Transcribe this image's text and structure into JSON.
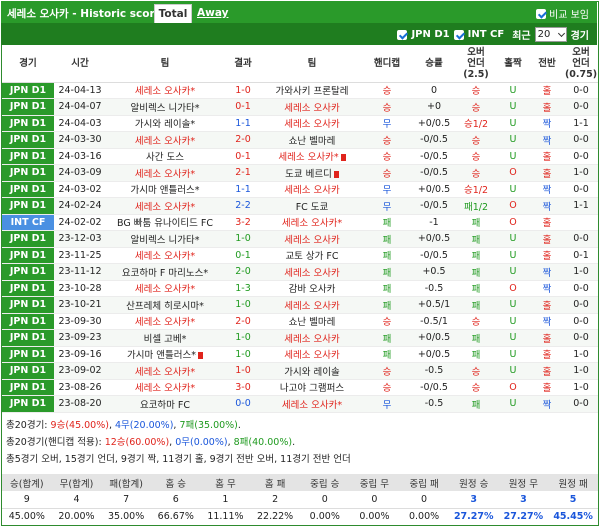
{
  "header": {
    "title": "세레소 오사카 - Historic scores",
    "tab_total": "Total",
    "tab_away": "Away",
    "compare_label": "비교 보임"
  },
  "filters": {
    "jpn_label": "JPN D1",
    "intcf_label": "INT CF",
    "recent_label": "최근",
    "recent_value": "20",
    "games_label": "경기"
  },
  "columns": [
    "경기",
    "시간",
    "팀",
    "결과",
    "팀",
    "핸디캡",
    "승률",
    "오버 언더 (2.5)",
    "홀짝",
    "전반",
    "오버 언더 (0.75)"
  ],
  "rows": [
    {
      "comp": "JPN D1",
      "date": "24-04-13",
      "home": "세레소 오사카*",
      "hc": "red",
      "score": "1-0",
      "sc": "red",
      "away": "가와사키 프론탈레",
      "ac": "",
      "hcp": "승",
      "hpc": "red",
      "hdcp": "0",
      "wr": "승",
      "wrc": "red",
      "ou": "U",
      "ouc": "green",
      "oe": "홀",
      "oec": "red",
      "ht": "0-0",
      "ou2": "U",
      "ou2c": "green"
    },
    {
      "comp": "JPN D1",
      "date": "24-04-07",
      "home": "알비렉스 니가타*",
      "hc": "",
      "score": "0-1",
      "sc": "red",
      "away": "세레소 오사카",
      "ac": "red",
      "hcp": "승",
      "hpc": "red",
      "hdcp": "+0",
      "wr": "승",
      "wrc": "red",
      "ou": "U",
      "ouc": "green",
      "oe": "홀",
      "oec": "red",
      "ht": "0-0",
      "ou2": "U",
      "ou2c": "green"
    },
    {
      "comp": "JPN D1",
      "date": "24-04-03",
      "home": "가시와 레이솔*",
      "hc": "",
      "score": "1-1",
      "sc": "blue",
      "away": "세레소 오사카",
      "ac": "red",
      "hcp": "무",
      "hpc": "blue",
      "hdcp": "+0/0.5",
      "wr": "승1/2",
      "wrc": "red",
      "ou": "U",
      "ouc": "green",
      "oe": "짝",
      "oec": "blue",
      "ht": "1-1",
      "ou2": "O",
      "ou2c": "red"
    },
    {
      "comp": "JPN D1",
      "date": "24-03-30",
      "home": "세레소 오사카*",
      "hc": "red",
      "score": "2-0",
      "sc": "red",
      "away": "쇼난 벨마레",
      "ac": "",
      "hcp": "승",
      "hpc": "red",
      "hdcp": "-0/0.5",
      "wr": "승",
      "wrc": "red",
      "ou": "U",
      "ouc": "green",
      "oe": "짝",
      "oec": "blue",
      "ht": "0-0",
      "ou2": "U",
      "ou2c": "green"
    },
    {
      "comp": "JPN D1",
      "date": "24-03-16",
      "home": "사간 도스",
      "hc": "",
      "score": "0-1",
      "sc": "red",
      "away": "세레소 오사카*",
      "ac": "red",
      "card": true,
      "hcp": "승",
      "hpc": "red",
      "hdcp": "-0/0.5",
      "wr": "승",
      "wrc": "red",
      "ou": "U",
      "ouc": "green",
      "oe": "홀",
      "oec": "red",
      "ht": "0-0",
      "ou2": "U",
      "ou2c": "green"
    },
    {
      "comp": "JPN D1",
      "date": "24-03-09",
      "home": "세레소 오사카*",
      "hc": "red",
      "score": "2-1",
      "sc": "red",
      "away": "도쿄 베르디",
      "ac": "",
      "card": true,
      "hcp": "승",
      "hpc": "red",
      "hdcp": "-0/0.5",
      "wr": "승",
      "wrc": "red",
      "ou": "O",
      "ouc": "red",
      "oe": "홀",
      "oec": "red",
      "ht": "1-0",
      "ou2": "O",
      "ou2c": "red"
    },
    {
      "comp": "JPN D1",
      "date": "24-03-02",
      "home": "가시마 앤틀러스*",
      "hc": "",
      "score": "1-1",
      "sc": "blue",
      "away": "세레소 오사카",
      "ac": "red",
      "hcp": "무",
      "hpc": "blue",
      "hdcp": "+0/0.5",
      "wr": "승1/2",
      "wrc": "red",
      "ou": "U",
      "ouc": "green",
      "oe": "짝",
      "oec": "blue",
      "ht": "0-0",
      "ou2": "U",
      "ou2c": "green"
    },
    {
      "comp": "JPN D1",
      "date": "24-02-24",
      "home": "세레소 오사카*",
      "hc": "red",
      "score": "2-2",
      "sc": "blue",
      "away": "FC 도쿄",
      "ac": "",
      "hcp": "무",
      "hpc": "blue",
      "hdcp": "-0/0.5",
      "wr": "패1/2",
      "wrc": "green",
      "ou": "O",
      "ouc": "red",
      "oe": "짝",
      "oec": "blue",
      "ht": "1-1",
      "ou2": "O",
      "ou2c": "red"
    },
    {
      "comp": "INT CF",
      "date": "24-02-02",
      "home": "BG 빠툼 유나이티드 FC",
      "hc": "",
      "score": "3-2",
      "sc": "red",
      "away": "세레소 오사카*",
      "ac": "red",
      "hcp": "패",
      "hpc": "green",
      "hdcp": "-1",
      "wr": "패",
      "wrc": "green",
      "ou": "O",
      "ouc": "red",
      "oe": "홀",
      "oec": "red",
      "ht": "",
      "ou2": "",
      "ou2c": ""
    },
    {
      "comp": "JPN D1",
      "date": "23-12-03",
      "home": "알비렉스 니가타*",
      "hc": "",
      "score": "1-0",
      "sc": "green",
      "away": "세레소 오사카",
      "ac": "red",
      "hcp": "패",
      "hpc": "green",
      "hdcp": "+0/0.5",
      "wr": "패",
      "wrc": "green",
      "ou": "U",
      "ouc": "green",
      "oe": "홀",
      "oec": "red",
      "ht": "0-0",
      "ou2": "U",
      "ou2c": "green"
    },
    {
      "comp": "JPN D1",
      "date": "23-11-25",
      "home": "세레소 오사카*",
      "hc": "red",
      "score": "0-1",
      "sc": "green",
      "away": "교토 상가 FC",
      "ac": "",
      "hcp": "패",
      "hpc": "green",
      "hdcp": "-0/0.5",
      "wr": "패",
      "wrc": "green",
      "ou": "U",
      "ouc": "green",
      "oe": "홀",
      "oec": "red",
      "ht": "0-1",
      "ou2": "O",
      "ou2c": "red"
    },
    {
      "comp": "JPN D1",
      "date": "23-11-12",
      "home": "요코하마 F 마리노스*",
      "hc": "",
      "score": "2-0",
      "sc": "green",
      "away": "세레소 오사카",
      "ac": "red",
      "hcp": "패",
      "hpc": "green",
      "hdcp": "+0.5",
      "wr": "패",
      "wrc": "green",
      "ou": "U",
      "ouc": "green",
      "oe": "짝",
      "oec": "blue",
      "ht": "1-0",
      "ou2": "O",
      "ou2c": "red"
    },
    {
      "comp": "JPN D1",
      "date": "23-10-28",
      "home": "세레소 오사카*",
      "hc": "red",
      "score": "1-3",
      "sc": "green",
      "away": "감바 오사카",
      "ac": "",
      "hcp": "패",
      "hpc": "green",
      "hdcp": "-0.5",
      "wr": "패",
      "wrc": "green",
      "ou": "O",
      "ouc": "red",
      "oe": "짝",
      "oec": "blue",
      "ht": "0-0",
      "ou2": "U",
      "ou2c": "green"
    },
    {
      "comp": "JPN D1",
      "date": "23-10-21",
      "home": "산프레체 히로시마*",
      "hc": "",
      "score": "1-0",
      "sc": "green",
      "away": "세레소 오사카",
      "ac": "red",
      "hcp": "패",
      "hpc": "green",
      "hdcp": "+0.5/1",
      "wr": "패",
      "wrc": "green",
      "ou": "U",
      "ouc": "green",
      "oe": "홀",
      "oec": "red",
      "ht": "0-0",
      "ou2": "U",
      "ou2c": "green"
    },
    {
      "comp": "JPN D1",
      "date": "23-09-30",
      "home": "세레소 오사카*",
      "hc": "red",
      "score": "2-0",
      "sc": "red",
      "away": "쇼난 벨마레",
      "ac": "",
      "hcp": "승",
      "hpc": "red",
      "hdcp": "-0.5/1",
      "wr": "승",
      "wrc": "red",
      "ou": "U",
      "ouc": "green",
      "oe": "짝",
      "oec": "blue",
      "ht": "0-0",
      "ou2": "U",
      "ou2c": "green"
    },
    {
      "comp": "JPN D1",
      "date": "23-09-23",
      "home": "비셀 고베*",
      "hc": "",
      "score": "1-0",
      "sc": "green",
      "away": "세레소 오사카",
      "ac": "red",
      "hcp": "패",
      "hpc": "green",
      "hdcp": "+0/0.5",
      "wr": "패",
      "wrc": "green",
      "ou": "U",
      "ouc": "green",
      "oe": "홀",
      "oec": "red",
      "ht": "0-0",
      "ou2": "U",
      "ou2c": "green"
    },
    {
      "comp": "JPN D1",
      "date": "23-09-16",
      "home": "가시마 앤틀러스*",
      "hc": "",
      "card": true,
      "score": "1-0",
      "sc": "green",
      "away": "세레소 오사카",
      "ac": "red",
      "hcp": "패",
      "hpc": "green",
      "hdcp": "+0/0.5",
      "wr": "패",
      "wrc": "green",
      "ou": "U",
      "ouc": "green",
      "oe": "홀",
      "oec": "red",
      "ht": "1-0",
      "ou2": "O",
      "ou2c": "red"
    },
    {
      "comp": "JPN D1",
      "date": "23-09-02",
      "home": "세레소 오사카*",
      "hc": "red",
      "score": "1-0",
      "sc": "red",
      "away": "가시와 레이솔",
      "ac": "",
      "hcp": "승",
      "hpc": "red",
      "hdcp": "-0.5",
      "wr": "승",
      "wrc": "red",
      "ou": "U",
      "ouc": "green",
      "oe": "홀",
      "oec": "red",
      "ht": "1-0",
      "ou2": "O",
      "ou2c": "red"
    },
    {
      "comp": "JPN D1",
      "date": "23-08-26",
      "home": "세레소 오사카*",
      "hc": "red",
      "score": "3-0",
      "sc": "red",
      "away": "나고야 그램퍼스",
      "ac": "",
      "hcp": "승",
      "hpc": "red",
      "hdcp": "-0/0.5",
      "wr": "승",
      "wrc": "red",
      "ou": "O",
      "ouc": "red",
      "oe": "홀",
      "oec": "red",
      "ht": "1-0",
      "ou2": "O",
      "ou2c": "red"
    },
    {
      "comp": "JPN D1",
      "date": "23-08-20",
      "home": "요코하마 FC",
      "hc": "",
      "score": "0-0",
      "sc": "blue",
      "away": "세레소 오사카*",
      "ac": "red",
      "hcp": "무",
      "hpc": "blue",
      "hdcp": "-0.5",
      "wr": "패",
      "wrc": "green",
      "ou": "U",
      "ouc": "green",
      "oe": "짝",
      "oec": "blue",
      "ht": "0-0",
      "ou2": "U",
      "ou2c": "green"
    }
  ],
  "summary": {
    "line1": {
      "prefix": "총20경기: ",
      "w": "9승(45.00%)",
      "sep1": ", ",
      "d": "4무(20.00%)",
      "sep2": ", ",
      "l": "7패(35.00%)",
      "suffix": "."
    },
    "line2": {
      "prefix": "총20경기(핸디캡 적용):",
      "w": "12승(60.00%)",
      "sep1": ", ",
      "d": "0무(0.00%)",
      "sep2": ", ",
      "l": "8패(40.00%)",
      "suffix": "."
    },
    "line3": "총5경기 오버, 15경기 언더, 9경기 짝, 11경기 홀, 9경기 전반 오버, 11경기 전반 언더"
  },
  "stats": {
    "headers": [
      "승(합계)",
      "무(합계)",
      "패(합계)",
      "홈 승",
      "홈 무",
      "홈 패",
      "중립 승",
      "중립 무",
      "중립 패",
      "원정 승",
      "원정 무",
      "원정 패"
    ],
    "counts": [
      "9",
      "4",
      "7",
      "6",
      "1",
      "2",
      "0",
      "0",
      "0",
      "3",
      "3",
      "5"
    ],
    "percents": [
      "45.00%",
      "20.00%",
      "35.00%",
      "66.67%",
      "11.11%",
      "22.22%",
      "0.00%",
      "0.00%",
      "0.00%",
      "27.27%",
      "27.27%",
      "45.45%"
    ]
  }
}
